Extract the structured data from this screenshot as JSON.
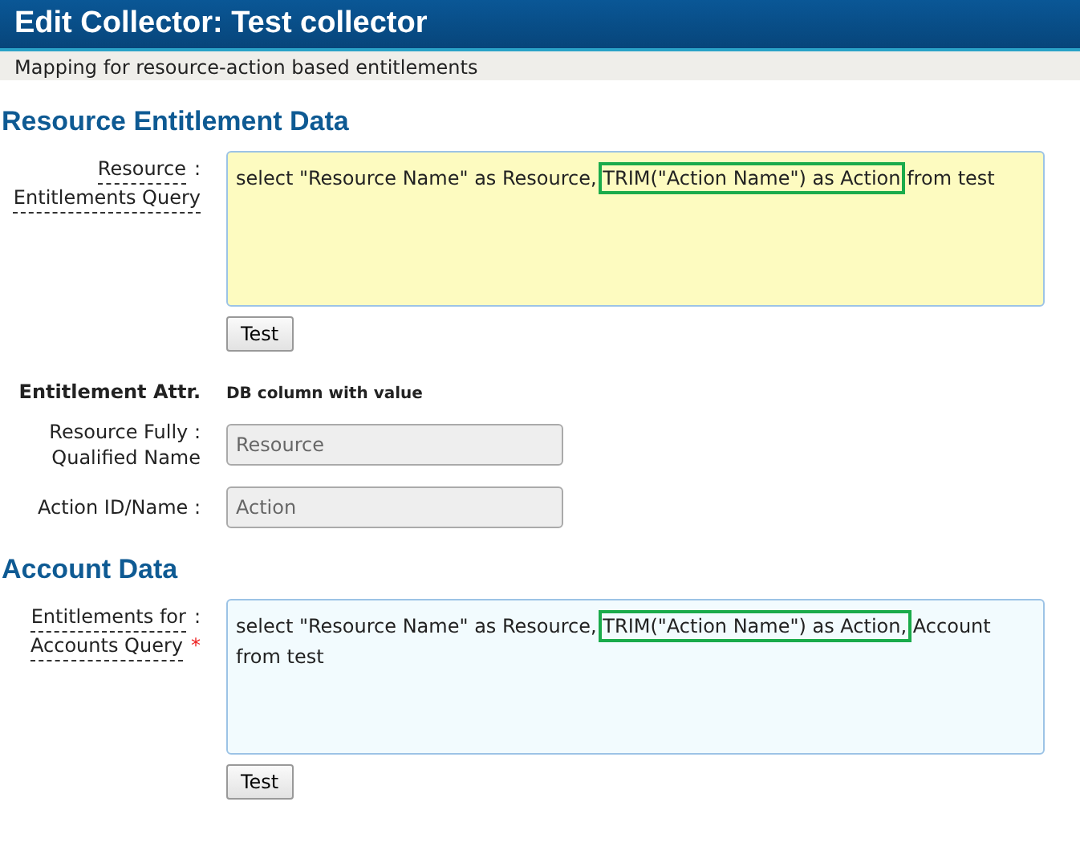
{
  "window": {
    "title": "Edit Collector: Test collector",
    "subtitle": "Mapping for resource-action based entitlements"
  },
  "sections": [
    {
      "heading": "Resource Entitlement Data",
      "query": {
        "label_lines": [
          "Resource",
          "Entitlements Query"
        ],
        "colon": ":",
        "before": "select \"Resource Name\" as Resource,",
        "highlight": "TRIM(\"Action Name\") as Action",
        "after": "from test",
        "focused": true,
        "button": "Test"
      },
      "attributes": {
        "header_label": "Entitlement Attr.",
        "header_value": "DB column with value",
        "rows": [
          {
            "label_lines": [
              "Resource Fully :",
              "Qualified Name"
            ],
            "value": "Resource"
          },
          {
            "label_lines": [
              "Action ID/Name :"
            ],
            "value": "Action"
          }
        ]
      }
    },
    {
      "heading": "Account Data",
      "query": {
        "label_lines": [
          "Entitlements for",
          "Accounts Query"
        ],
        "colon": ":",
        "required_mark": "*",
        "before": "select \"Resource Name\" as Resource,",
        "highlight": "TRIM(\"Action Name\") as Action,",
        "after": "Account from test",
        "focused": false,
        "button": "Test"
      }
    }
  ]
}
